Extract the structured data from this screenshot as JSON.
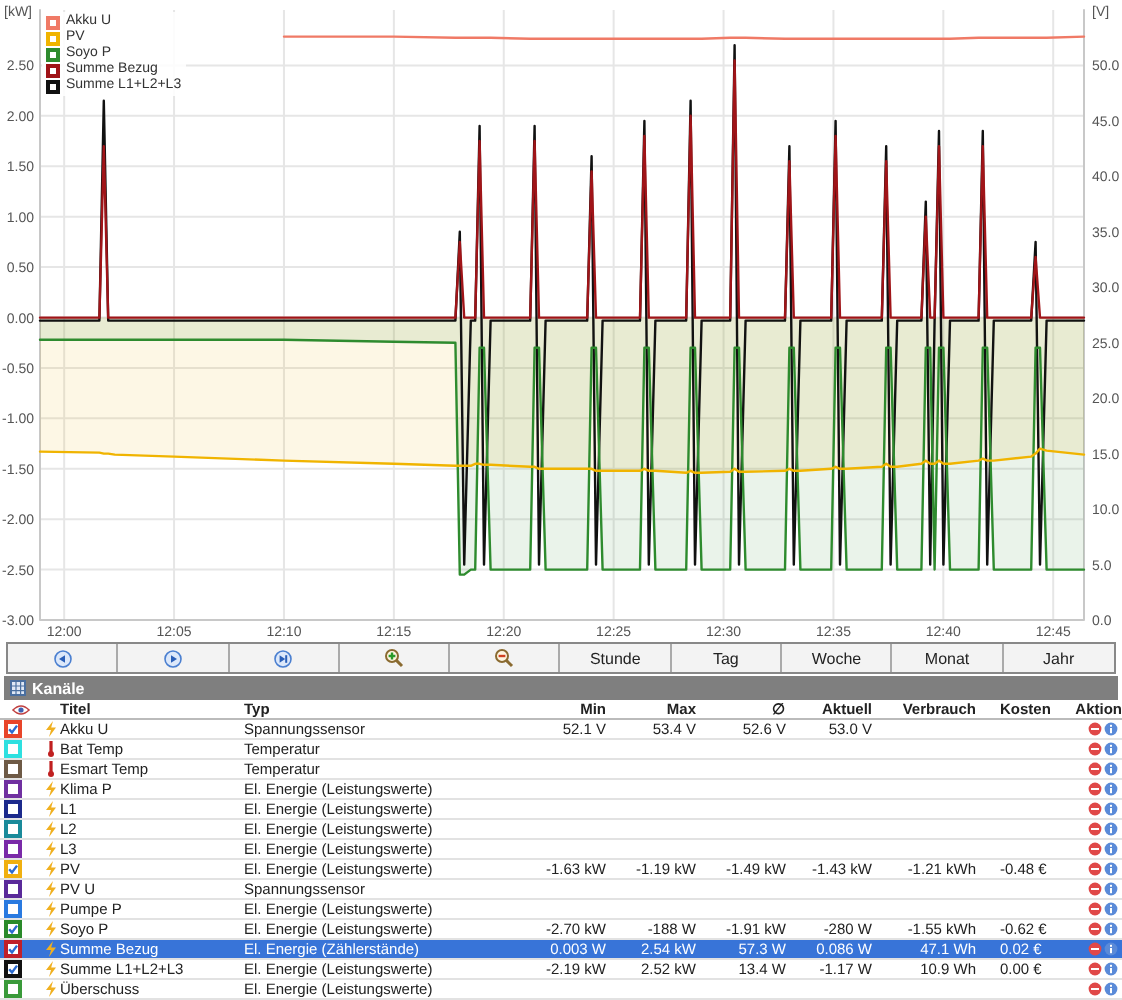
{
  "chart": {
    "chart_data": {
      "type": "line",
      "ylabel": "[kW]",
      "y2label": "[V]",
      "grid": true,
      "legend": "upper left",
      "x": [
        718.9,
        721.6,
        721.8,
        722.0,
        722.3,
        725,
        730,
        735,
        737.8,
        738.0,
        738.2,
        738.5,
        738.7,
        738.9,
        739.1,
        739.4,
        741.2,
        741.4,
        741.6,
        741.9,
        743.8,
        744.0,
        744.2,
        744.5,
        746.2,
        746.4,
        746.6,
        746.9,
        748.3,
        748.5,
        748.7,
        749.0,
        750.3,
        750.5,
        750.7,
        751.0,
        752.8,
        753.0,
        753.2,
        753.5,
        754.9,
        755.1,
        755.3,
        755.6,
        757.2,
        757.4,
        757.6,
        757.9,
        759.0,
        759.2,
        759.4,
        759.6,
        759.8,
        760.0,
        760.3,
        761.6,
        761.8,
        762.0,
        762.3,
        764.0,
        764.2,
        764.4,
        764.7,
        766.4
      ],
      "xlim": [
        718.9,
        766.4
      ],
      "ylim": [
        -3,
        3.05
      ],
      "y2lim": [
        0,
        55
      ],
      "xticks": [
        {
          "value": 720,
          "label": "12:00"
        },
        {
          "value": 725,
          "label": "12:05"
        },
        {
          "value": 730,
          "label": "12:10"
        },
        {
          "value": 735,
          "label": "12:15"
        },
        {
          "value": 740,
          "label": "12:20"
        },
        {
          "value": 745,
          "label": "12:25"
        },
        {
          "value": 750,
          "label": "12:30"
        },
        {
          "value": 755,
          "label": "12:35"
        },
        {
          "value": 760,
          "label": "12:40"
        },
        {
          "value": 765,
          "label": "12:45"
        }
      ],
      "yticks": [
        {
          "value": -3,
          "label": "-3.00"
        },
        {
          "value": -2.5,
          "label": "-2.50"
        },
        {
          "value": -2,
          "label": "-2.00"
        },
        {
          "value": -1.5,
          "label": "-1.50"
        },
        {
          "value": -1,
          "label": "-1.00"
        },
        {
          "value": -0.5,
          "label": "-0.50"
        },
        {
          "value": 0,
          "label": "0.00"
        },
        {
          "value": 0.5,
          "label": "0.50"
        },
        {
          "value": 1,
          "label": "1.00"
        },
        {
          "value": 1.5,
          "label": "1.50"
        },
        {
          "value": 2,
          "label": "2.00"
        },
        {
          "value": 2.5,
          "label": "2.50"
        }
      ],
      "y2ticks": [
        {
          "value": 0,
          "label": "0.0"
        },
        {
          "value": 5,
          "label": "5.0"
        },
        {
          "value": 10,
          "label": "10.0"
        },
        {
          "value": 15,
          "label": "15.0"
        },
        {
          "value": 20,
          "label": "20.0"
        },
        {
          "value": 25,
          "label": "25.0"
        },
        {
          "value": 30,
          "label": "30.0"
        },
        {
          "value": 35,
          "label": "35.0"
        },
        {
          "value": 40,
          "label": "40.0"
        },
        {
          "value": 45,
          "label": "45.0"
        },
        {
          "value": 50,
          "label": "50.0"
        }
      ],
      "series": [
        {
          "name": "Akku U",
          "color": "#f07a66",
          "axis": "y2",
          "values": [
            null,
            null,
            null,
            null,
            null,
            null,
            52.6,
            52.6,
            52.5,
            52.5,
            52.5,
            52.5,
            52.5,
            52.5,
            52.5,
            52.5,
            52.4,
            52.4,
            52.4,
            52.4,
            52.4,
            52.4,
            52.4,
            52.4,
            52.4,
            52.4,
            52.4,
            52.4,
            52.4,
            52.4,
            52.4,
            52.4,
            52.5,
            52.5,
            52.5,
            52.5,
            52.4,
            52.4,
            52.4,
            52.4,
            52.4,
            52.4,
            52.4,
            52.4,
            52.4,
            52.4,
            52.4,
            52.4,
            52.4,
            52.4,
            52.4,
            52.4,
            52.4,
            52.4,
            52.4,
            52.5,
            52.5,
            52.5,
            52.5,
            52.5,
            52.5,
            52.5,
            52.5,
            52.6
          ]
        },
        {
          "name": "PV",
          "color": "#f0b400",
          "type": "area",
          "values": [
            -1.33,
            -1.34,
            -1.35,
            -1.35,
            -1.36,
            -1.38,
            -1.42,
            -1.45,
            -1.47,
            -1.47,
            -1.47,
            -1.47,
            -1.45,
            -1.45,
            -1.46,
            -1.46,
            -1.48,
            -1.48,
            -1.5,
            -1.5,
            -1.5,
            -1.5,
            -1.52,
            -1.52,
            -1.52,
            -1.5,
            -1.52,
            -1.52,
            -1.54,
            -1.52,
            -1.54,
            -1.54,
            -1.53,
            -1.5,
            -1.53,
            -1.53,
            -1.52,
            -1.5,
            -1.52,
            -1.52,
            -1.5,
            -1.48,
            -1.5,
            -1.5,
            -1.48,
            -1.45,
            -1.48,
            -1.48,
            -1.45,
            -1.42,
            -1.45,
            -1.45,
            -1.42,
            -1.45,
            -1.45,
            -1.42,
            -1.4,
            -1.42,
            -1.42,
            -1.38,
            -1.35,
            -1.3,
            -1.32,
            -1.36
          ]
        },
        {
          "name": "Soyo P",
          "color": "#2e8b2e",
          "type": "area",
          "values": [
            -0.22,
            -0.22,
            -0.22,
            -0.22,
            -0.22,
            -0.22,
            -0.22,
            -0.24,
            -0.25,
            -2.55,
            -2.55,
            -2.5,
            -2.5,
            -0.3,
            -0.3,
            -2.5,
            -2.5,
            -0.3,
            -0.3,
            -2.5,
            -2.5,
            -0.3,
            -0.3,
            -2.5,
            -2.5,
            -0.3,
            -0.3,
            -2.5,
            -2.5,
            -0.3,
            -0.3,
            -2.5,
            -2.5,
            -0.3,
            -0.3,
            -2.5,
            -2.5,
            -0.3,
            -0.3,
            -2.5,
            -2.5,
            -0.3,
            -0.3,
            -2.5,
            -2.5,
            -0.3,
            -0.3,
            -2.5,
            -2.5,
            -0.3,
            -0.3,
            -2.5,
            -0.3,
            -0.3,
            -2.5,
            -2.5,
            -0.3,
            -0.3,
            -2.5,
            -2.5,
            -0.3,
            -0.3,
            -2.5,
            -2.5
          ]
        },
        {
          "name": "Summe Bezug",
          "color": "#a01418",
          "values": [
            0,
            0,
            1.7,
            0,
            0,
            0,
            0,
            0,
            0,
            0.75,
            0,
            0,
            0,
            1.75,
            0,
            0,
            0,
            1.75,
            0,
            0,
            0,
            1.45,
            0,
            0,
            0,
            1.8,
            0,
            0,
            0,
            2.0,
            0,
            0,
            0,
            2.55,
            0,
            0,
            0,
            1.55,
            0,
            0,
            0,
            1.8,
            0,
            0,
            0,
            1.55,
            0,
            0,
            0,
            1.0,
            0,
            0,
            1.7,
            0,
            0,
            0,
            1.7,
            0,
            0,
            0,
            0.6,
            0,
            0,
            0
          ]
        },
        {
          "name": "Summe L1+L2+L3",
          "color": "#111111",
          "values": [
            -0.03,
            -0.03,
            2.15,
            -0.03,
            -0.03,
            -0.03,
            -0.03,
            -0.03,
            -0.03,
            0.85,
            -2.45,
            -0.03,
            -0.03,
            1.9,
            -2.45,
            -0.03,
            -0.03,
            1.9,
            -2.45,
            -0.03,
            -0.03,
            1.6,
            -2.45,
            -0.03,
            -0.03,
            1.95,
            -2.45,
            -0.03,
            -0.03,
            2.15,
            -2.45,
            -0.03,
            -0.03,
            2.7,
            -2.45,
            -0.03,
            -0.03,
            1.7,
            -2.45,
            -0.03,
            -0.03,
            1.95,
            -2.45,
            -0.03,
            -0.03,
            1.7,
            -2.45,
            -0.03,
            -0.03,
            1.15,
            -2.45,
            -0.03,
            1.85,
            -2.45,
            -0.03,
            -0.03,
            1.85,
            -2.45,
            -0.03,
            -0.03,
            0.75,
            -2.45,
            -0.03,
            -0.03
          ]
        }
      ]
    }
  },
  "toolbar": [
    {
      "kind": "back"
    },
    {
      "kind": "forward"
    },
    {
      "kind": "end"
    },
    {
      "kind": "zoom-in"
    },
    {
      "kind": "zoom-out"
    },
    {
      "kind": "text",
      "label": "Stunde"
    },
    {
      "kind": "text",
      "label": "Tag"
    },
    {
      "kind": "text",
      "label": "Woche"
    },
    {
      "kind": "text",
      "label": "Monat"
    },
    {
      "kind": "text",
      "label": "Jahr"
    }
  ],
  "panel": {
    "title": "Kanäle"
  },
  "table": {
    "columns": [
      "Titel",
      "Typ",
      "Min",
      "Max",
      "∅",
      "Aktuell",
      "Verbrauch",
      "Kosten",
      "Aktion"
    ],
    "rows": [
      {
        "color": "#e8452a",
        "checked": true,
        "kind": "power",
        "title": "Akku U",
        "type": "Spannungssensor",
        "min": "52.1 V",
        "max": "53.4 V",
        "avg": "52.6 V",
        "current": "53.0 V",
        "selected": false
      },
      {
        "color": "#2ee0e0",
        "checked": false,
        "kind": "temperature",
        "title": "Bat Temp",
        "type": "Temperatur",
        "selected": false
      },
      {
        "color": "#6e5a46",
        "checked": false,
        "kind": "temperature",
        "title": "Esmart Temp",
        "type": "Temperatur",
        "selected": false
      },
      {
        "color": "#7030a0",
        "checked": false,
        "kind": "power",
        "title": "Klima P",
        "type": "El. Energie (Leistungswerte)",
        "selected": false
      },
      {
        "color": "#1c2a8c",
        "checked": false,
        "kind": "power",
        "title": "L1",
        "type": "El. Energie (Leistungswerte)",
        "selected": false
      },
      {
        "color": "#1a8a9a",
        "checked": false,
        "kind": "power",
        "title": "L2",
        "type": "El. Energie (Leistungswerte)",
        "selected": false
      },
      {
        "color": "#7a2aa8",
        "checked": false,
        "kind": "power",
        "title": "L3",
        "type": "El. Energie (Leistungswerte)",
        "selected": false
      },
      {
        "color": "#f0b010",
        "checked": true,
        "kind": "power",
        "title": "PV",
        "type": "El. Energie (Leistungswerte)",
        "min": "-1.63 kW",
        "max": "-1.19 kW",
        "avg": "-1.49 kW",
        "current": "-1.43 kW",
        "consumption": "-1.21 kWh",
        "cost": "-0.48 €",
        "selected": false
      },
      {
        "color": "#5a2a9a",
        "checked": false,
        "kind": "power",
        "title": "PV U",
        "type": "Spannungssensor",
        "selected": false
      },
      {
        "color": "#2a7ae0",
        "checked": false,
        "kind": "power",
        "title": "Pumpe P",
        "type": "El. Energie (Leistungswerte)",
        "selected": false
      },
      {
        "color": "#2a8a2a",
        "checked": true,
        "kind": "power",
        "title": "Soyo P",
        "type": "El. Energie (Leistungswerte)",
        "min": "-2.70 kW",
        "max": "-188 W",
        "avg": "-1.91 kW",
        "current": "-280 W",
        "consumption": "-1.55 kWh",
        "cost": "-0.62 €",
        "selected": false
      },
      {
        "color": "#c0202a",
        "checked": true,
        "kind": "power",
        "title": "Summe Bezug",
        "type": "El. Energie (Zählerstände)",
        "min": "0.003 W",
        "max": "2.54 kW",
        "avg": "57.3 W",
        "current": "0.086 W",
        "consumption": "47.1 Wh",
        "cost": "0.02 €",
        "selected": true
      },
      {
        "color": "#111111",
        "checked": true,
        "kind": "power",
        "title": "Summe L1+L2+L3",
        "type": "El. Energie (Leistungswerte)",
        "min": "-2.19 kW",
        "max": "2.52 kW",
        "avg": "13.4 W",
        "current": "-1.17 W",
        "consumption": "10.9 Wh",
        "cost": "0.00 €",
        "selected": false
      },
      {
        "color": "#3a9a3a",
        "checked": false,
        "kind": "power",
        "title": "Überschuss",
        "type": "El. Energie (Leistungswerte)",
        "selected": false
      }
    ]
  }
}
